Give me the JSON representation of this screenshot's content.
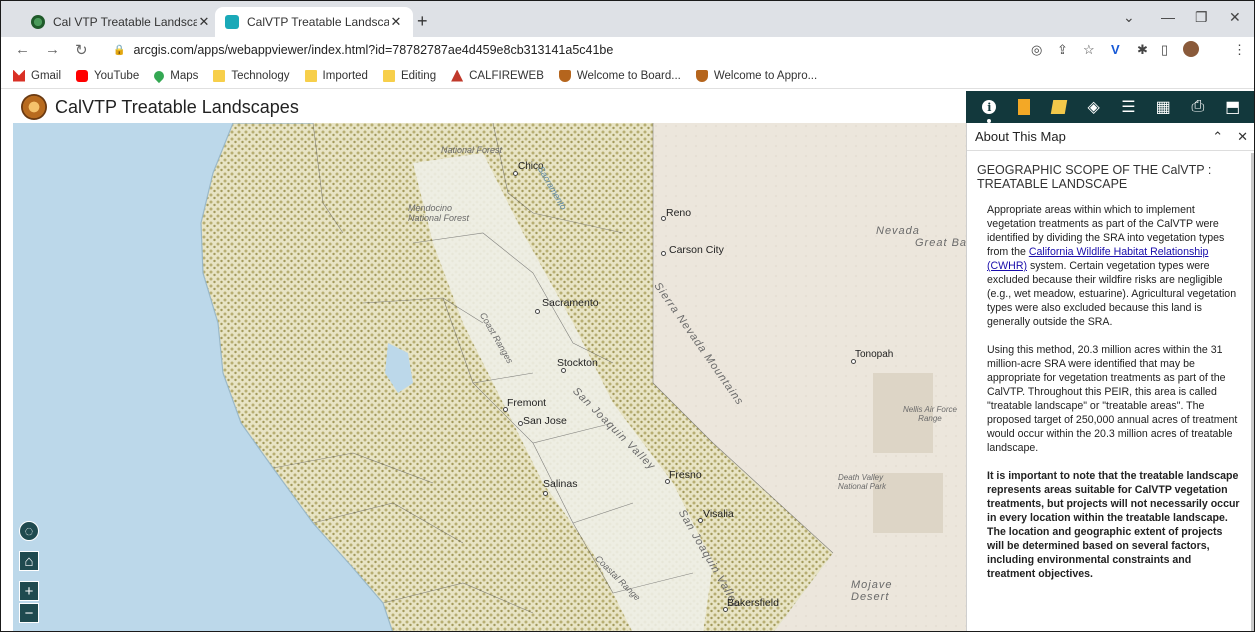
{
  "browser": {
    "tabs": [
      {
        "title": "Cal VTP Treatable Landscapes - V",
        "active": false
      },
      {
        "title": "CalVTP Treatable Landscapes",
        "active": true
      }
    ],
    "url": "arcgis.com/apps/webappviewer/index.html?id=78782787ae4d459e8cb313141a5c41be",
    "bookmarks": [
      {
        "label": "Gmail",
        "icon": "gmail-icon",
        "color": "#d93025"
      },
      {
        "label": "YouTube",
        "icon": "youtube-icon",
        "color": "#ff0000"
      },
      {
        "label": "Maps",
        "icon": "maps-pin-icon",
        "color": "#34a853"
      },
      {
        "label": "Technology",
        "icon": "folder-icon",
        "color": "#f7cf4a"
      },
      {
        "label": "Imported",
        "icon": "folder-icon",
        "color": "#f7cf4a"
      },
      {
        "label": "Editing",
        "icon": "folder-icon",
        "color": "#f7cf4a"
      },
      {
        "label": "CALFIREWEB",
        "icon": "flame-icon",
        "color": "#c0392b"
      },
      {
        "label": "Welcome to Board...",
        "icon": "shield-icon",
        "color": "#b5651d"
      },
      {
        "label": "Welcome to Appro...",
        "icon": "shield-icon",
        "color": "#b5651d"
      }
    ]
  },
  "app": {
    "title": "CalVTP Treatable Landscapes",
    "accent": "#12383c"
  },
  "toolbar_icons": [
    "info-icon",
    "legend-icon",
    "layer-list-icon",
    "layers-icon",
    "list-icon",
    "basemap-gallery-icon",
    "print-icon",
    "share-icon"
  ],
  "map": {
    "labels": {
      "national_forest": "National Forest",
      "mendocino_nf": "Mendocino\nNational Forest",
      "chico": "Chico",
      "reno": "Reno",
      "carson_city": "Carson City",
      "nevada": "Nevada",
      "great_basin": "Great Bas",
      "sacramento": "Sacramento",
      "coast_ranges": "Coast Ranges",
      "sierra_nevada": "Sierra Nevada Mountains",
      "stockton": "Stockton",
      "tonopah": "Tonopah",
      "fremont": "Fremont",
      "san_jose": "San Jose",
      "san_joaquin_valley": "San Joaquin Valley",
      "nellis": "Nellis Air Force\nRange",
      "fresno": "Fresno",
      "salinas": "Salinas",
      "visalia": "Visalia",
      "death_valley": "Death Valley\nNational Park",
      "coastal_range": "Coastal Range",
      "san_joaquin_valley_2": "San Joaquin Valley",
      "mojave_desert": "Mojave\nDesert",
      "bakersfield": "Bakersfield",
      "sacramento_river": "Sacramento"
    },
    "controls": [
      "locate-icon",
      "home-icon",
      "zoom-in-icon",
      "zoom-out-icon"
    ]
  },
  "panel": {
    "title": "About This Map",
    "section_title": "GEOGRAPHIC SCOPE OF THE CalVTP : TREATABLE LANDSCAPE",
    "para1_before": "Appropriate areas within which to implement vegetation treatments as part of the CalVTP were identified by dividing the SRA into vegetation types from the ",
    "para1_link": "California Wildlife Habitat Relationship (CWHR)",
    "para1_after": " system. Certain vegetation types were excluded because their wildfire risks are negligible (e.g., wet meadow, estuarine). Agricultural vegetation types were also excluded because this land is generally outside the SRA.",
    "para2": "Using this method, 20.3 million acres within the 31 million-acre SRA were identified that may be appropriate for vegetation treatments as part of the CalVTP. Throughout this PEIR, this area is called \"treatable landscape\" or \"treatable areas\". The proposed target of 250,000 annual acres of treatment would occur within the 20.3 million acres of treatable landscape.",
    "para3": "It is important to note that the treatable landscape represents areas suitable for CalVTP vegetation treatments, but projects will not necessarily occur in every location within the treatable landscape. The location and geographic extent of projects will be determined based on several factors, including environmental constraints and treatment objectives."
  }
}
